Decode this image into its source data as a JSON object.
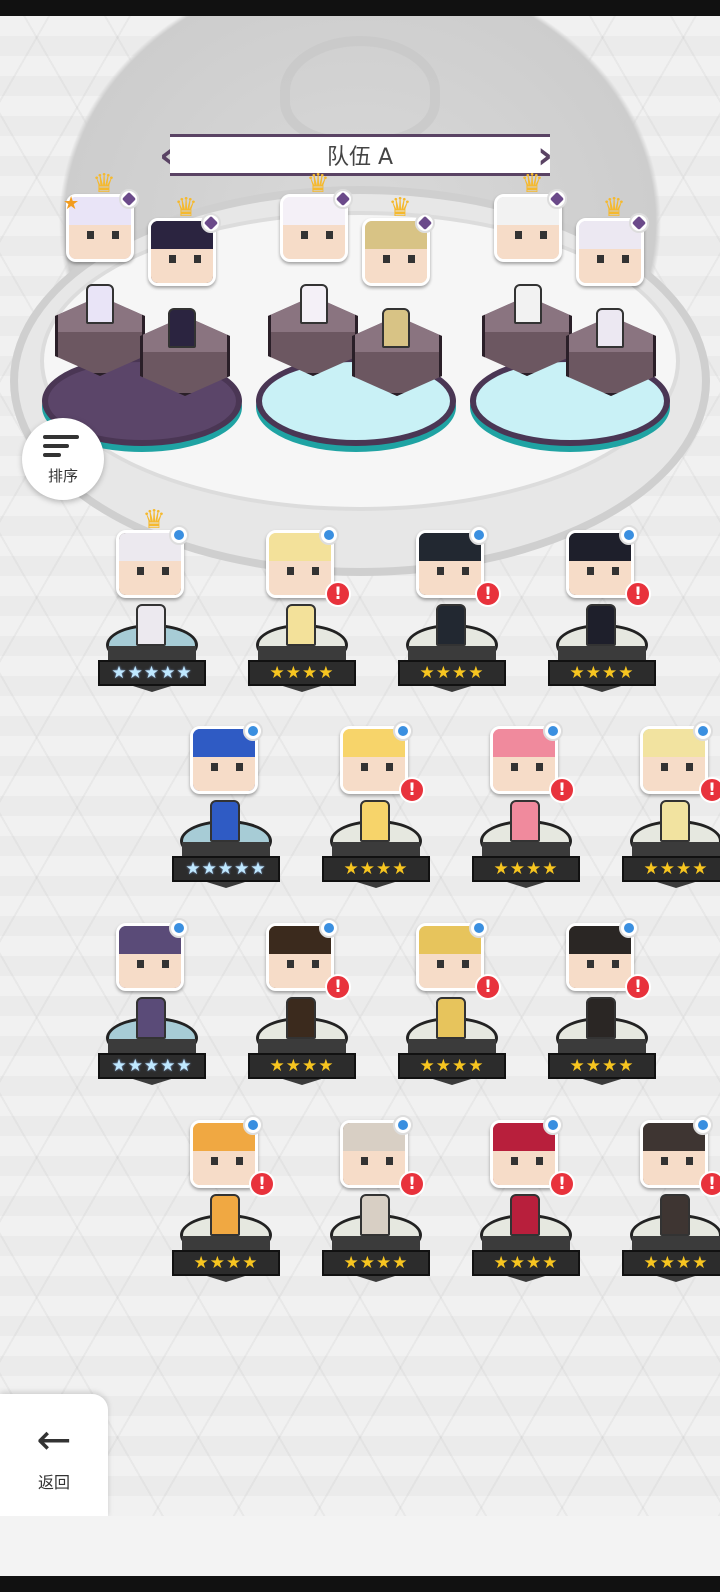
{
  "team_banner": {
    "title": "队伍 A",
    "prev_icon": "chevron-left-icon",
    "next_icon": "chevron-right-icon"
  },
  "team_slots": [
    {
      "members": [
        {
          "portrait_color": "#c9c3e6",
          "hair": "#e9e4f7",
          "leader": true,
          "crown": true
        },
        {
          "portrait_color": "#3b3550",
          "hair": "#2b2440",
          "leader": false,
          "crown": true
        }
      ]
    },
    {
      "members": [
        {
          "portrait_color": "#efe7f0",
          "hair": "#f4f0f7",
          "leader": false,
          "crown": true
        },
        {
          "portrait_color": "#e6d7a6",
          "hair": "#d8c385",
          "leader": false,
          "crown": true
        }
      ]
    },
    {
      "members": [
        {
          "portrait_color": "#d9d9d9",
          "hair": "#f2f2f2",
          "leader": false,
          "crown": true
        },
        {
          "portrait_color": "#d9d3e4",
          "hair": "#ece8f2",
          "leader": false,
          "crown": true
        }
      ]
    }
  ],
  "sort_button": {
    "label": "排序",
    "icon": "sort-icon"
  },
  "back_button": {
    "label": "返回",
    "icon": "arrow-left-icon"
  },
  "roster": [
    [
      {
        "color": "#4a3a33",
        "hair": "#ece9ef",
        "stars": "★★★★★",
        "rainbow": true,
        "crown": true,
        "alert": false
      },
      {
        "color": "#f1dca4",
        "hair": "#f3e19a",
        "stars": "★★★★",
        "rainbow": false,
        "crown": false,
        "alert": true
      },
      {
        "color": "#2f3640",
        "hair": "#222831",
        "stars": "★★★★",
        "rainbow": false,
        "crown": false,
        "alert": true
      },
      {
        "color": "#2b2b38",
        "hair": "#1e1f2b",
        "stars": "★★★★",
        "rainbow": false,
        "crown": false,
        "alert": true
      }
    ],
    [
      {
        "color": "#3c6fd8",
        "hair": "#2f5bc4",
        "stars": "★★★★★",
        "rainbow": true,
        "crown": false,
        "alert": false
      },
      {
        "color": "#f5d884",
        "hair": "#f7d46a",
        "stars": "★★★★",
        "rainbow": false,
        "crown": false,
        "alert": true
      },
      {
        "color": "#f2a9b4",
        "hair": "#f08a9d",
        "stars": "★★★★",
        "rainbow": false,
        "crown": false,
        "alert": true
      },
      {
        "color": "#7fd1d8",
        "hair": "#f2e3a0",
        "stars": "★★★★",
        "rainbow": false,
        "crown": false,
        "alert": true
      }
    ],
    [
      {
        "color": "#6a5a8a",
        "hair": "#5a4b78",
        "stars": "★★★★★",
        "rainbow": true,
        "crown": false,
        "alert": false
      },
      {
        "color": "#7a5030",
        "hair": "#3b2a1d",
        "stars": "★★★★",
        "rainbow": false,
        "crown": false,
        "alert": true
      },
      {
        "color": "#c9d1dc",
        "hair": "#e7c45c",
        "stars": "★★★★",
        "rainbow": false,
        "crown": false,
        "alert": true
      },
      {
        "color": "#8a5a3a",
        "hair": "#2a2624",
        "stars": "★★★★",
        "rainbow": false,
        "crown": false,
        "alert": true
      }
    ],
    [
      {
        "color": "#f2b45a",
        "hair": "#f0a842",
        "stars": "★★★★",
        "rainbow": false,
        "crown": false,
        "alert": true
      },
      {
        "color": "#6a4a3a",
        "hair": "#d8cfc4",
        "stars": "★★★★",
        "rainbow": false,
        "crown": false,
        "alert": true
      },
      {
        "color": "#c2304a",
        "hair": "#b81f3c",
        "stars": "★★★★",
        "rainbow": false,
        "crown": false,
        "alert": true
      },
      {
        "color": "#5a4c46",
        "hair": "#3e3532",
        "stars": "★★★★",
        "rainbow": false,
        "crown": false,
        "alert": true
      }
    ]
  ],
  "alert_glyph": "!"
}
